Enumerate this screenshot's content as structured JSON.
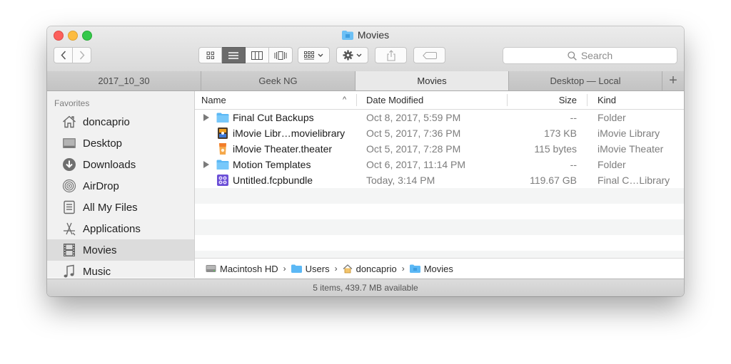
{
  "window": {
    "title": "Movies"
  },
  "toolbar": {
    "back_icon": "chevron-left-icon",
    "forward_icon": "chevron-right-icon",
    "view_modes": [
      "icon-view",
      "list-view",
      "column-view",
      "cover-flow-view"
    ],
    "active_view": "list-view",
    "search_placeholder": "Search"
  },
  "tabs": [
    {
      "label": "2017_10_30",
      "active": false
    },
    {
      "label": "Geek NG",
      "active": false
    },
    {
      "label": "Movies",
      "active": true
    },
    {
      "label": "Desktop — Local",
      "active": false
    }
  ],
  "tab_add_label": "+",
  "sidebar": {
    "heading": "Favorites",
    "items": [
      {
        "label": "doncaprio",
        "icon": "home-icon"
      },
      {
        "label": "Desktop",
        "icon": "desktop-icon"
      },
      {
        "label": "Downloads",
        "icon": "downloads-icon"
      },
      {
        "label": "AirDrop",
        "icon": "airdrop-icon"
      },
      {
        "label": "All My Files",
        "icon": "all-files-icon"
      },
      {
        "label": "Applications",
        "icon": "applications-icon"
      },
      {
        "label": "Movies",
        "icon": "film-icon",
        "selected": true
      },
      {
        "label": "Music",
        "icon": "music-icon"
      }
    ]
  },
  "columns": {
    "name": "Name",
    "date": "Date Modified",
    "size": "Size",
    "kind": "Kind",
    "sort_indicator": "^"
  },
  "files": [
    {
      "name": "Final Cut Backups",
      "date": "Oct 8, 2017, 5:59 PM",
      "size": "--",
      "kind": "Folder",
      "icon": "folder-icon",
      "expandable": true
    },
    {
      "name": "iMovie Libr…movielibrary",
      "date": "Oct 5, 2017, 7:36 PM",
      "size": "173 KB",
      "kind": "iMovie Library",
      "icon": "imovie-library-icon",
      "expandable": false
    },
    {
      "name": "iMovie Theater.theater",
      "date": "Oct 5, 2017, 7:28 PM",
      "size": "115 bytes",
      "kind": "iMovie Theater",
      "icon": "imovie-theater-icon",
      "expandable": false
    },
    {
      "name": "Motion Templates",
      "date": "Oct 6, 2017, 11:14 PM",
      "size": "--",
      "kind": "Folder",
      "icon": "folder-icon",
      "expandable": true
    },
    {
      "name": "Untitled.fcpbundle",
      "date": "Today, 3:14 PM",
      "size": "119.67 GB",
      "kind": "Final C…Library",
      "icon": "fcp-library-icon",
      "expandable": false
    }
  ],
  "pathbar": [
    {
      "label": "Macintosh HD",
      "icon": "hard-drive-icon"
    },
    {
      "label": "Users",
      "icon": "folder-icon"
    },
    {
      "label": "doncaprio",
      "icon": "home-icon"
    },
    {
      "label": "Movies",
      "icon": "folder-icon"
    }
  ],
  "status": "5 items, 439.7 MB available",
  "colors": {
    "folder": "#5bb8f5",
    "selected_sidebar": "#dcdcdc",
    "close": "#fc605c",
    "minimize": "#fdbc40",
    "maximize": "#34c84a"
  }
}
